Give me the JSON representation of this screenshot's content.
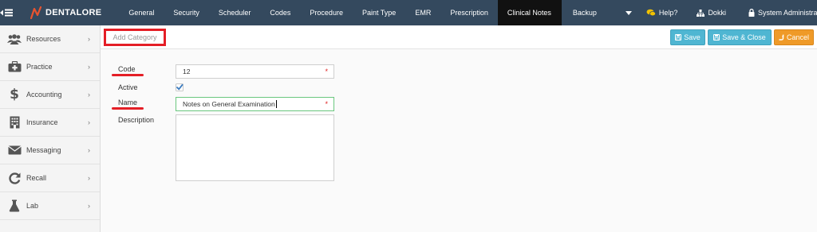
{
  "brand": {
    "name": "DENTALORE"
  },
  "nav": {
    "items": [
      "General",
      "Security",
      "Scheduler",
      "Codes",
      "Procedure",
      "Paint Type",
      "EMR",
      "Prescription",
      "Clinical Notes",
      "Backup"
    ],
    "active": "Clinical Notes",
    "help_label": "Help?",
    "clinic_label": "Dokki",
    "user_label": "System Administrator"
  },
  "sidebar": {
    "items": [
      {
        "label": "Resources",
        "icon": "users-icon"
      },
      {
        "label": "Practice",
        "icon": "medkit-icon"
      },
      {
        "label": "Accounting",
        "icon": "dollar-icon"
      },
      {
        "label": "Insurance",
        "icon": "building-icon"
      },
      {
        "label": "Messaging",
        "icon": "envelope-icon"
      },
      {
        "label": "Recall",
        "icon": "refresh-icon"
      },
      {
        "label": "Lab",
        "icon": "flask-icon"
      }
    ]
  },
  "toolbar": {
    "title_placeholder": "Add Category",
    "save_label": "Save",
    "save_close_label": "Save & Close",
    "cancel_label": "Cancel"
  },
  "form": {
    "code_label": "Code",
    "code_value": "12",
    "active_label": "Active",
    "active_checked": true,
    "name_label": "Name",
    "name_value": "Notes on General Examination",
    "description_label": "Description",
    "description_value": "",
    "required_mark": "*"
  },
  "colors": {
    "topbar": "#34495e",
    "active_tab": "#111111",
    "primary_button": "#4fb6d2",
    "cancel_button": "#ef9a28",
    "annotation_red": "#e41e26"
  }
}
